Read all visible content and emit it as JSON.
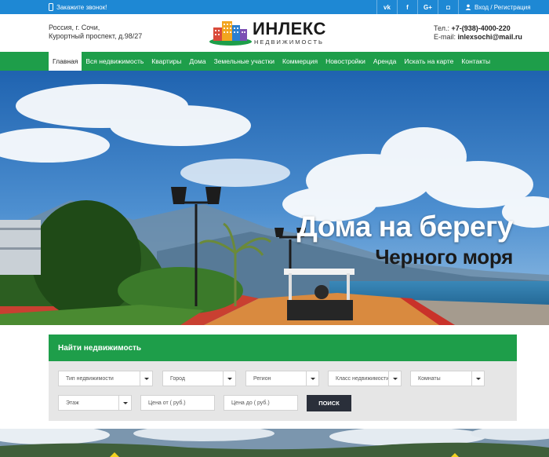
{
  "topbar": {
    "call_label": "Закажите звонок!",
    "socials": [
      "vk",
      "f",
      "G+",
      "◘"
    ],
    "login_label": "Вход / Регистрация"
  },
  "header": {
    "address_line1": "Россия, г. Сочи,",
    "address_line2": "Курортный проспект, д.98/27",
    "brand": "ИНЛЕКС",
    "brand_sub": "НЕДВИЖИМОСТЬ",
    "phone_prefix": "Тел.: ",
    "phone": "+7-(938)-4000-220",
    "email_prefix": "E-mail: ",
    "email": "inlexsochi@mail.ru"
  },
  "nav": {
    "items": [
      "Главная",
      "Вся недвижимость",
      "Квартиры",
      "Дома",
      "Земельные участки",
      "Коммерция",
      "Новостройки",
      "Аренда",
      "Искать на карте",
      "Контакты"
    ],
    "active_index": 0
  },
  "hero": {
    "headline": "Дома на берегу",
    "subheadline": "Черного моря"
  },
  "search": {
    "title": "Найти недвижимость",
    "type_placeholder": "Тип недвижимости",
    "city_placeholder": "Город",
    "region_placeholder": "Регион",
    "class_placeholder": "Класс недвижимости",
    "rooms_placeholder": "Комнаты",
    "floor_placeholder": "Этаж",
    "price_from_placeholder": "Цена от ( руб.)",
    "price_to_placeholder": "Цена до ( руб.)",
    "button_label": "ПОИСК"
  },
  "colors": {
    "topbar": "#1e88d4",
    "nav": "#1e9e4a",
    "search_button": "#2a2f3a"
  }
}
